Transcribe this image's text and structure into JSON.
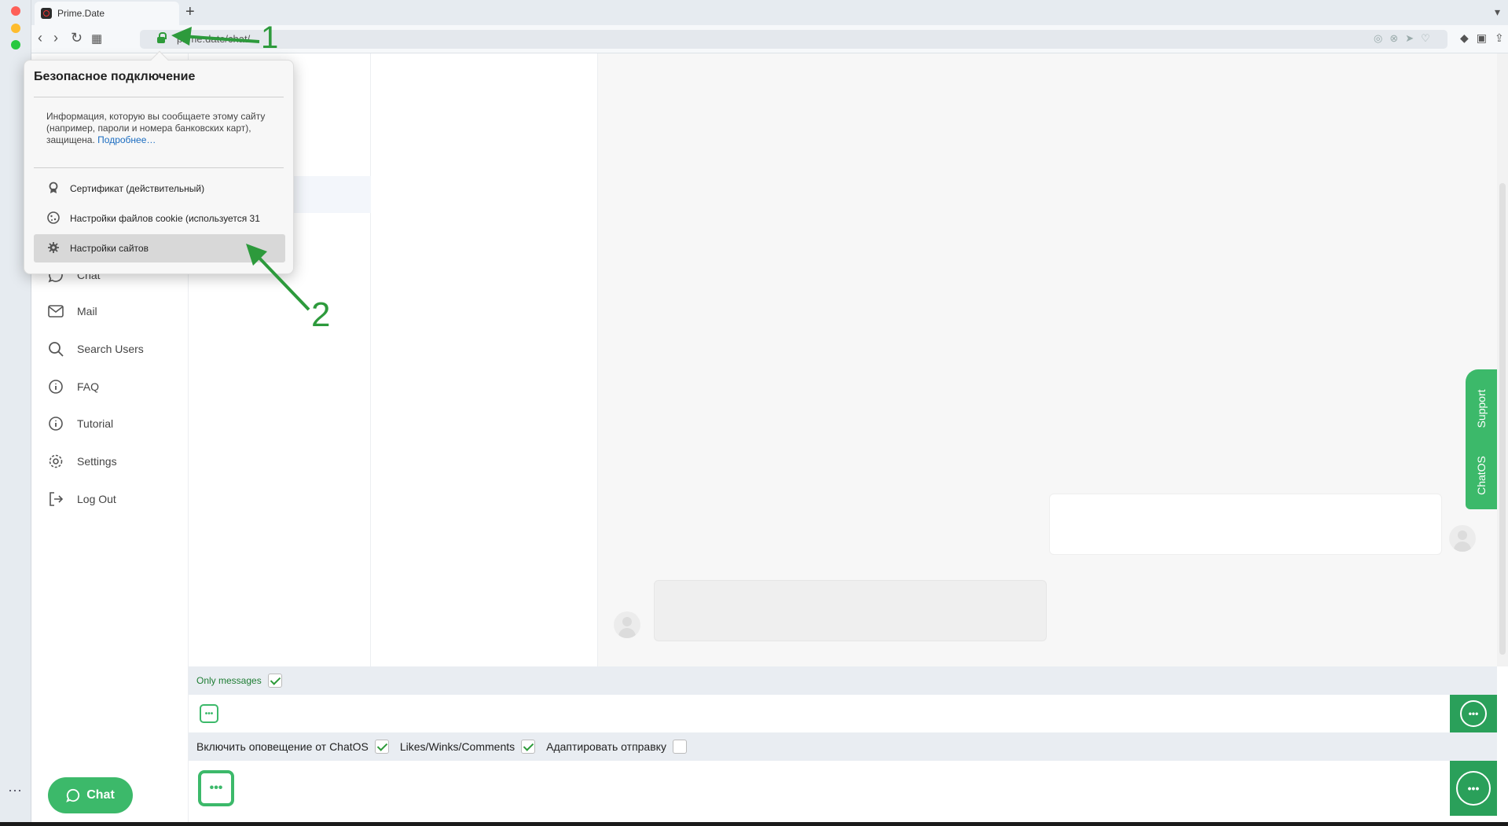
{
  "browser": {
    "tab_title": "Prime.Date",
    "new_tab": "+",
    "url": "prime.date/chat/",
    "nav": {
      "back": "‹",
      "forward": "›",
      "reload": "↻",
      "grid": "▦"
    },
    "url_icons": "◎⊗➤♡",
    "ext_icons": "◆▣⇪≡",
    "tab_menu": "▾",
    "more": "⋯",
    "colors": {
      "green": "#3cb96a",
      "link": "#1a6cc0"
    }
  },
  "popup": {
    "title": "Безопасное подключение",
    "info": "Информация, которую вы сообщаете этому сайту (например, пароли и номера банковских карт), защищена.",
    "link": "Подробнее…",
    "items": [
      {
        "label": "Сертификат (действительный)",
        "icon": "certificate-icon"
      },
      {
        "label": "Настройки файлов cookie (используется 31",
        "icon": "cookie-icon"
      },
      {
        "label": "Настройки сайтов",
        "icon": "gear-icon"
      }
    ]
  },
  "annotations": {
    "one": "1",
    "two": "2"
  },
  "sidebar": {
    "items": [
      {
        "label": "Chat",
        "icon": "chat-icon"
      },
      {
        "label": "Mail",
        "icon": "mail-icon"
      },
      {
        "label": "Search Users",
        "icon": "search-icon"
      },
      {
        "label": "FAQ",
        "icon": "info-icon"
      },
      {
        "label": "Tutorial",
        "icon": "info-icon"
      },
      {
        "label": "Settings",
        "icon": "gear-icon"
      },
      {
        "label": "Log Out",
        "icon": "logout-icon"
      }
    ],
    "chat_button": "Chat"
  },
  "support_tab": {
    "support": "Support",
    "chatos": "ChatOS"
  },
  "bottom": {
    "only_messages": "Only messages",
    "only_messages_checked": true,
    "notify_label": "Включить оповещение от ChatOS",
    "notify_checked": true,
    "likes_label": "Likes/Winks/Comments",
    "likes_checked": true,
    "adapt_label": "Адаптировать отправку",
    "adapt_checked": false
  }
}
